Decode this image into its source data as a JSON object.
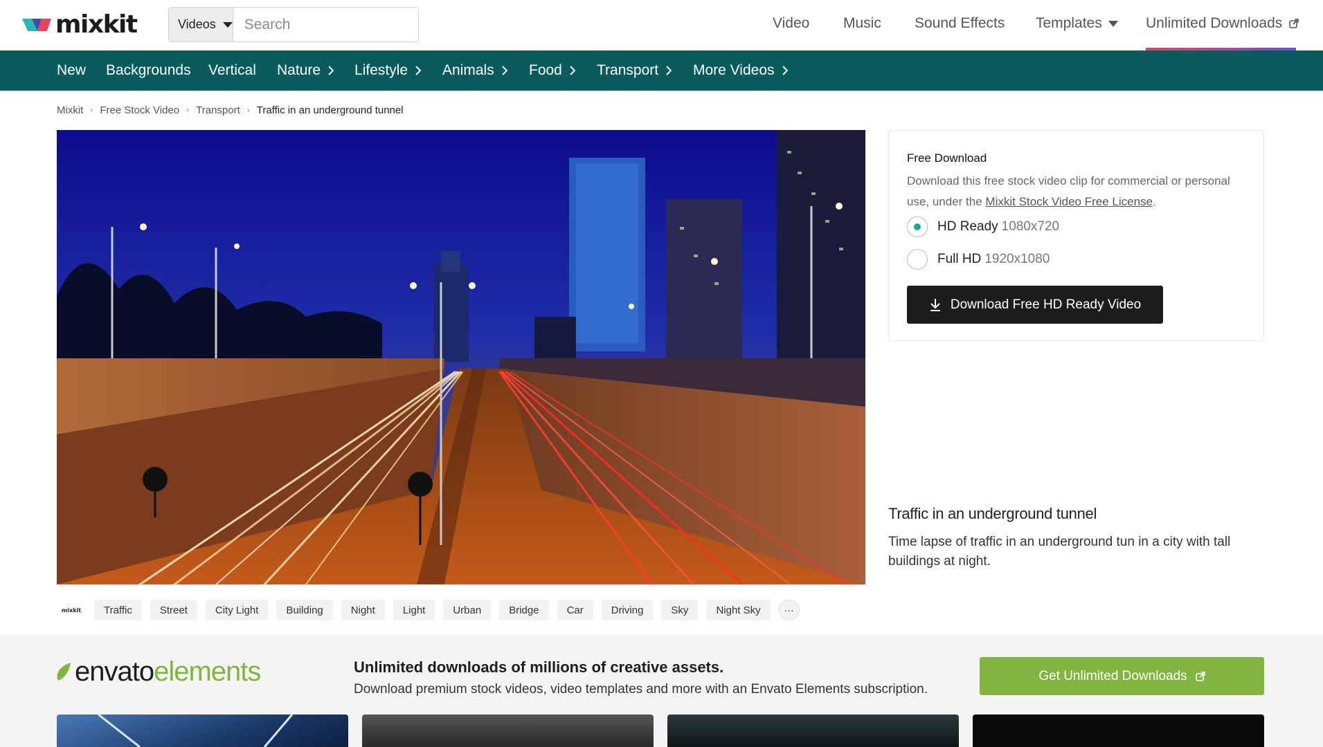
{
  "header": {
    "logo_text": "mixkit",
    "search": {
      "type_label": "Videos",
      "placeholder": "Search"
    },
    "nav": [
      {
        "label": "Video"
      },
      {
        "label": "Music"
      },
      {
        "label": "Sound Effects"
      },
      {
        "label": "Templates"
      },
      {
        "label": "Unlimited Downloads"
      }
    ]
  },
  "categories": [
    {
      "label": "New",
      "has_chevron": false
    },
    {
      "label": "Backgrounds",
      "has_chevron": false
    },
    {
      "label": "Vertical",
      "has_chevron": false
    },
    {
      "label": "Nature",
      "has_chevron": true
    },
    {
      "label": "Lifestyle",
      "has_chevron": true
    },
    {
      "label": "Animals",
      "has_chevron": true
    },
    {
      "label": "Food",
      "has_chevron": true
    },
    {
      "label": "Transport",
      "has_chevron": true
    },
    {
      "label": "More Videos",
      "has_chevron": true
    }
  ],
  "breadcrumb": [
    "Mixkit",
    "Free Stock Video",
    "Transport",
    "Traffic in an underground tunnel"
  ],
  "download": {
    "title": "Free Download",
    "desc_prefix": "Download this free stock video clip for commercial or personal use, under the ",
    "license_link": "Mixkit Stock Video Free License",
    "desc_suffix": ".",
    "options": [
      {
        "label": "HD Ready",
        "resolution": "1080x720",
        "checked": true
      },
      {
        "label": "Full HD",
        "resolution": "1920x1080",
        "checked": false
      }
    ],
    "button_label": "Download Free HD Ready Video"
  },
  "video": {
    "title": "Traffic in an underground tunnel",
    "description": "Time lapse of traffic in an underground tun in a city with tall buildings at night."
  },
  "tags": {
    "logo_text": "mixkit",
    "items": [
      "Traffic",
      "Street",
      "City Light",
      "Building",
      "Night",
      "Light",
      "Urban",
      "Bridge",
      "Car",
      "Driving",
      "Sky",
      "Night Sky"
    ],
    "more_label": "···"
  },
  "envato": {
    "logo_word1": "envato",
    "logo_word2": "elements",
    "headline": "Unlimited downloads of millions of creative assets.",
    "subtext": "Download premium stock videos, video templates and more with an Envato Elements subscription.",
    "button_label": "Get Unlimited Downloads"
  },
  "colors": {
    "category_bar": "#0a5c5c",
    "radio_accent": "#18a5a5",
    "envato_green": "#82b440",
    "download_button": "#1d1d1d"
  }
}
